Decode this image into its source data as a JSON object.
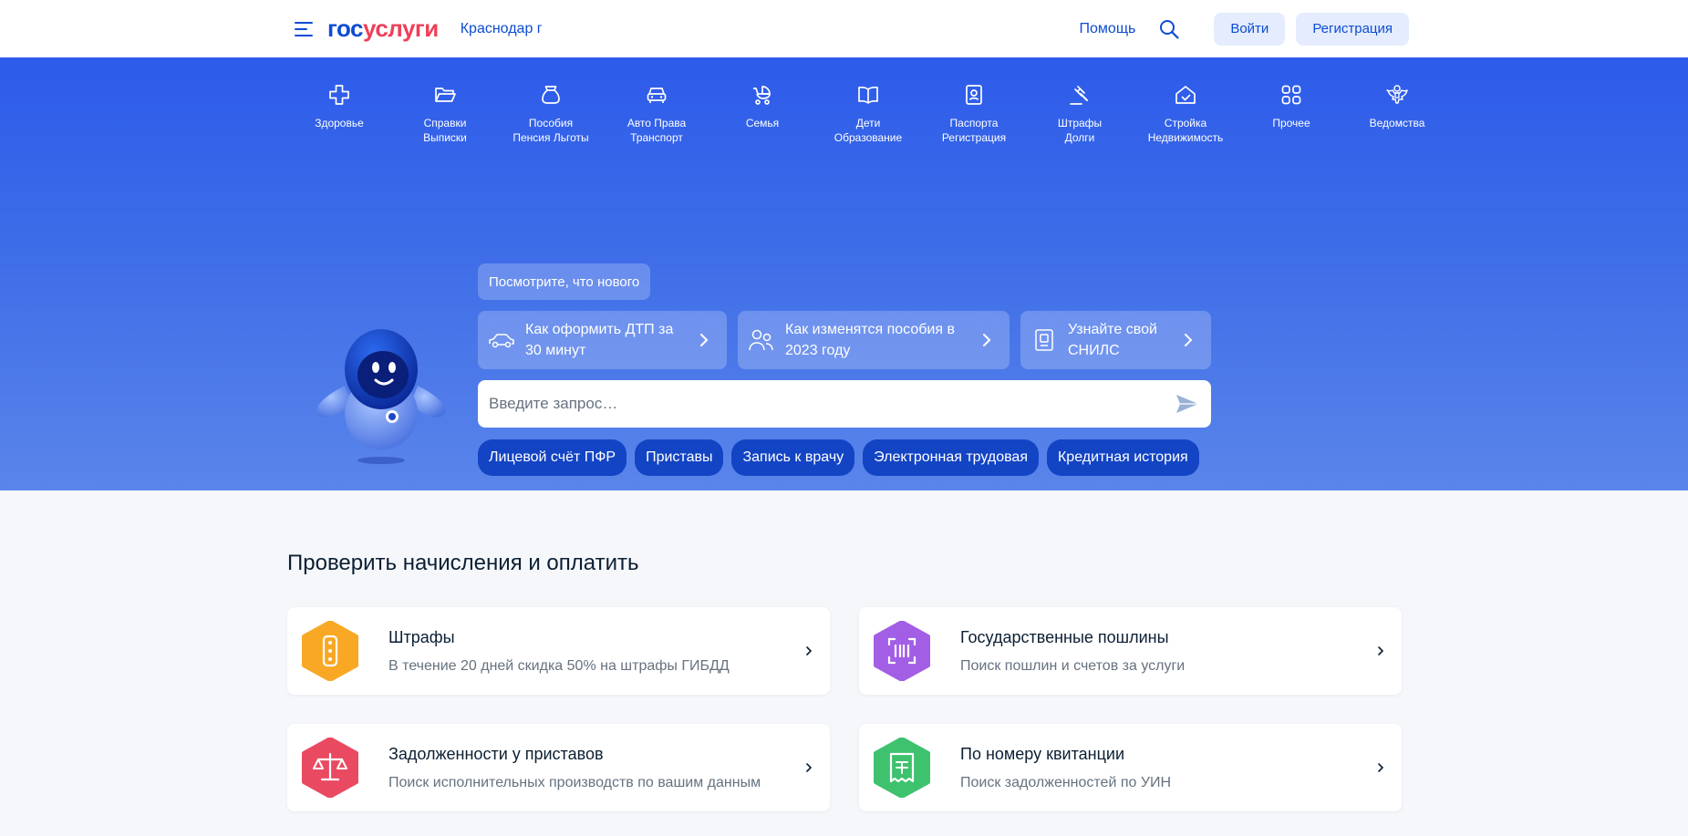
{
  "header": {
    "logo_gos": "гос",
    "logo_uslugi": "услуги",
    "region": "Краснодар г",
    "help": "Помощь",
    "login": "Войти",
    "register": "Регистрация"
  },
  "categories": [
    {
      "label": "Здоровье",
      "icon": "health-cross-icon"
    },
    {
      "label": "Справки\nВыписки",
      "icon": "folder-icon"
    },
    {
      "label": "Пособия\nПенсия Льготы",
      "icon": "money-bag-icon"
    },
    {
      "label": "Авто Права\nТранспорт",
      "icon": "car-icon"
    },
    {
      "label": "Семья",
      "icon": "stroller-icon"
    },
    {
      "label": "Дети\nОбразование",
      "icon": "book-icon"
    },
    {
      "label": "Паспорта\nРегистрация",
      "icon": "passport-icon"
    },
    {
      "label": "Штрафы\nДолги",
      "icon": "gavel-icon"
    },
    {
      "label": "Стройка\nНедвижимость",
      "icon": "house-icon"
    },
    {
      "label": "Прочее",
      "icon": "grid-icon"
    },
    {
      "label": "Ведомства",
      "icon": "coat-of-arms-icon"
    }
  ],
  "hero": {
    "news_tag": "Посмотрите, что нового",
    "news": [
      {
        "text": "Как оформить ДТП за 30 минут",
        "icon": "car-outline-icon"
      },
      {
        "text": "Как изменятся пособия в 2023 году",
        "icon": "people-icon"
      },
      {
        "text": "Узнайте свой СНИЛС",
        "icon": "document-card-icon"
      }
    ],
    "search_placeholder": "Введите запрос…",
    "chips": [
      "Лицевой счёт ПФР",
      "Приставы",
      "Запись к врачу",
      "Электронная трудовая",
      "Кредитная история"
    ]
  },
  "payments": {
    "title": "Проверить начисления и оплатить",
    "cards": [
      {
        "title": "Штрафы",
        "subtitle": "В течение 20 дней скидка 50% на штрафы ГИБДД",
        "icon": "traffic-light-icon",
        "color": "#f9a825"
      },
      {
        "title": "Государственные пошлины",
        "subtitle": "Поиск пошлин и счетов за услуги",
        "icon": "barcode-scan-icon",
        "color": "#a35ee6"
      },
      {
        "title": "Задолженности у приставов",
        "subtitle": "Поиск исполнительных производств по вашим данным",
        "icon": "scales-icon",
        "color": "#e94a61"
      },
      {
        "title": "По номеру квитанции",
        "subtitle": "Поиск задолженностей по УИН",
        "icon": "receipt-icon",
        "color": "#3ec26e"
      }
    ]
  },
  "colors": {
    "primary": "#0d4cd3",
    "accent_red": "#ee3f58",
    "hero_blue": "#2d5bea"
  }
}
